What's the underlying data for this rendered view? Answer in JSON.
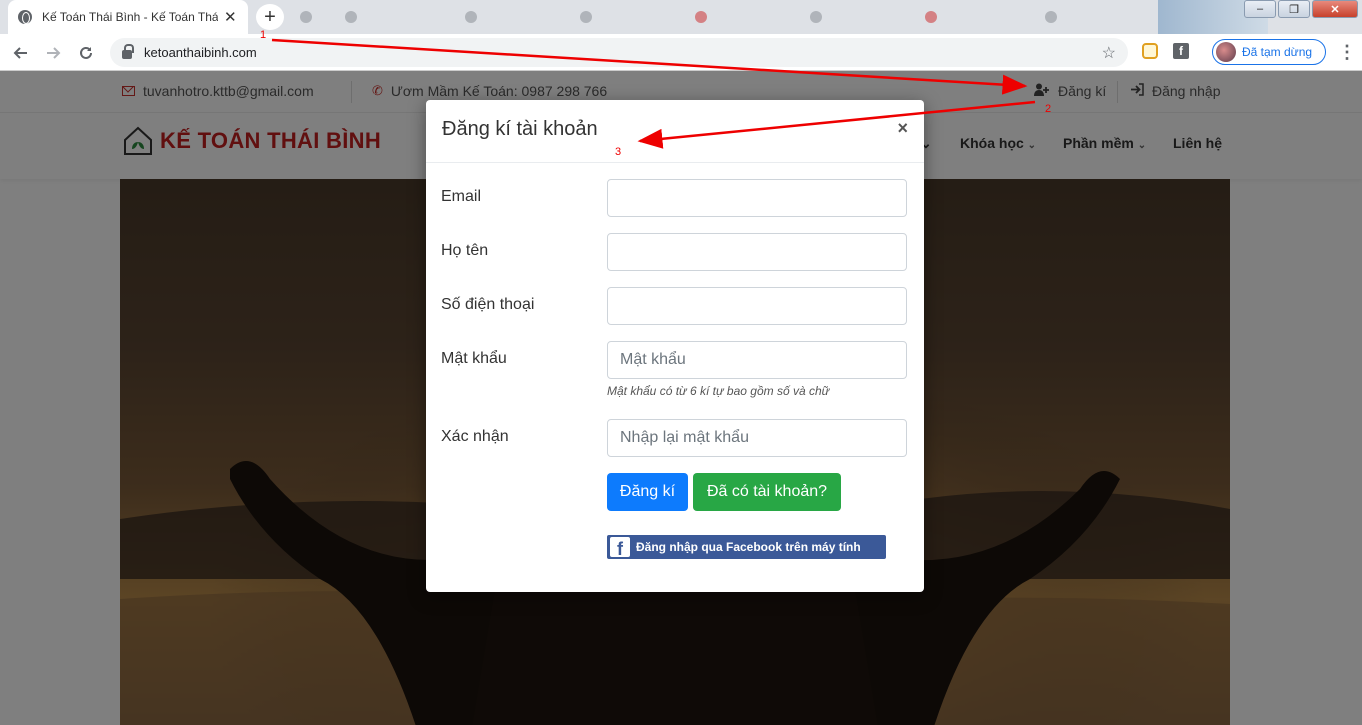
{
  "browser": {
    "tab_title": "Kế Toán Thái Bình - Kế Toán Thái Bình",
    "tab_close": "✕",
    "new_tab": "+",
    "url": "ketoanthaibinh.com",
    "profile_status": "Đã tạm dừng",
    "window_controls": [
      "–",
      "❐",
      "✕"
    ]
  },
  "site": {
    "topbar": {
      "email": "tuvanhotro.kttb@gmail.com",
      "phone": "Ươm Mầm Kế Toán: 0987 298 766",
      "register": "Đăng kí",
      "login": "Đăng nhập"
    },
    "logo_text": "KẾ TOÁN THÁI BÌNH",
    "menu": [
      {
        "label": "Khóa học",
        "dropdown": true
      },
      {
        "label": "Phần mềm",
        "dropdown": true
      },
      {
        "label": "Liên hệ",
        "dropdown": false
      }
    ]
  },
  "modal": {
    "title": "Đăng kí tài khoản",
    "close": "×",
    "fields": [
      {
        "label": "Email",
        "placeholder": "",
        "value": ""
      },
      {
        "label": "Họ tên",
        "placeholder": "",
        "value": ""
      },
      {
        "label": "Số điện thoại",
        "placeholder": "",
        "value": ""
      },
      {
        "label": "Mật khẩu",
        "placeholder": "Mật khẩu",
        "value": "",
        "help": "Mật khẩu có từ 6 kí tự bao gồm số và chữ"
      },
      {
        "label": "Xác nhận",
        "placeholder": "Nhập lại mật khẩu",
        "value": ""
      }
    ],
    "register_button": "Đăng kí",
    "have_account_button": "Đã có tài khoản?",
    "facebook_button": "Đăng nhập qua Facebook trên máy tính"
  },
  "annotations": [
    "1",
    "2",
    "3"
  ],
  "colors": {
    "annotation": "#ee0000",
    "primary_button": "#0d7bfd",
    "success_button": "#28a745",
    "facebook": "#3b5998",
    "logo": "#c21f1f"
  }
}
